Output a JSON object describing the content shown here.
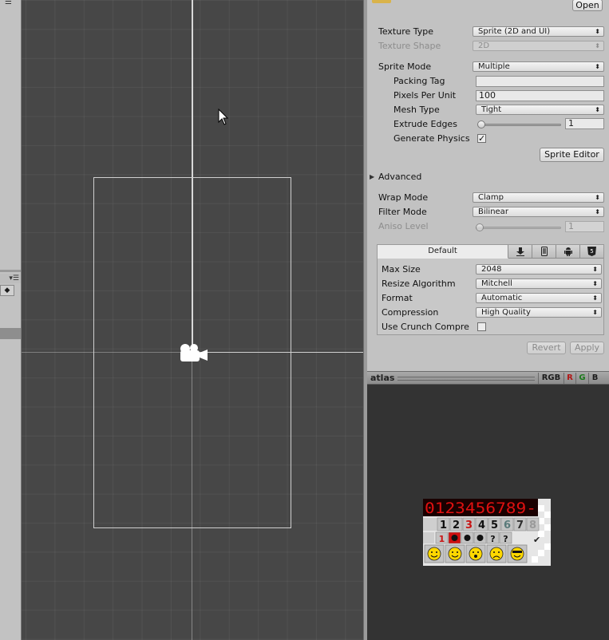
{
  "inspector": {
    "open_button": "Open",
    "texture_type": {
      "label": "Texture Type",
      "value": "Sprite (2D and UI)"
    },
    "texture_shape": {
      "label": "Texture Shape",
      "value": "2D"
    },
    "sprite_mode": {
      "label": "Sprite Mode",
      "value": "Multiple"
    },
    "packing_tag": {
      "label": "Packing Tag",
      "value": ""
    },
    "pixels_per_unit": {
      "label": "Pixels Per Unit",
      "value": "100"
    },
    "mesh_type": {
      "label": "Mesh Type",
      "value": "Tight"
    },
    "extrude_edges": {
      "label": "Extrude Edges",
      "value": "1",
      "slider_fraction": 0.0
    },
    "generate_physics": {
      "label": "Generate Physics",
      "checked": true
    },
    "sprite_editor_button": "Sprite Editor",
    "advanced": {
      "label": "Advanced",
      "expanded": false
    },
    "wrap_mode": {
      "label": "Wrap Mode",
      "value": "Clamp"
    },
    "filter_mode": {
      "label": "Filter Mode",
      "value": "Bilinear"
    },
    "aniso_level": {
      "label": "Aniso Level",
      "value": "1",
      "slider_fraction": 0.0
    },
    "platform_tabs": [
      {
        "label": "Default",
        "icon": "",
        "active": true
      },
      {
        "label": "",
        "icon": "download-icon",
        "active": false
      },
      {
        "label": "",
        "icon": "mobile-icon",
        "active": false
      },
      {
        "label": "",
        "icon": "android-icon",
        "active": false
      },
      {
        "label": "",
        "icon": "html5-icon",
        "active": false
      }
    ],
    "max_size": {
      "label": "Max Size",
      "value": "2048"
    },
    "resize_algorithm": {
      "label": "Resize Algorithm",
      "value": "Mitchell"
    },
    "format": {
      "label": "Format",
      "value": "Automatic"
    },
    "compression": {
      "label": "Compression",
      "value": "High Quality"
    },
    "use_crunch": {
      "label": "Use Crunch Compre",
      "checked": false
    },
    "revert_button": "Revert",
    "apply_button": "Apply"
  },
  "preview": {
    "title": "atlas",
    "channels": [
      "RGB",
      "R",
      "G",
      "B"
    ],
    "channel_colors": {
      "RGB": "#1c1c1c",
      "R": "#b01818",
      "G": "#1a7a1a",
      "B": "#1c1c1c"
    },
    "atlas_digits_red": "0123456789-",
    "atlas_digits_grey": [
      "1",
      "2",
      "3",
      "4",
      "5",
      "6",
      "7",
      "8"
    ],
    "atlas_symbols": [
      "1",
      "mine",
      "mine",
      "mine",
      "?",
      "?"
    ]
  },
  "colors": {
    "scene_bg": "#474747",
    "inspector_bg": "#c2c2c2",
    "preview_bg": "#333333"
  }
}
